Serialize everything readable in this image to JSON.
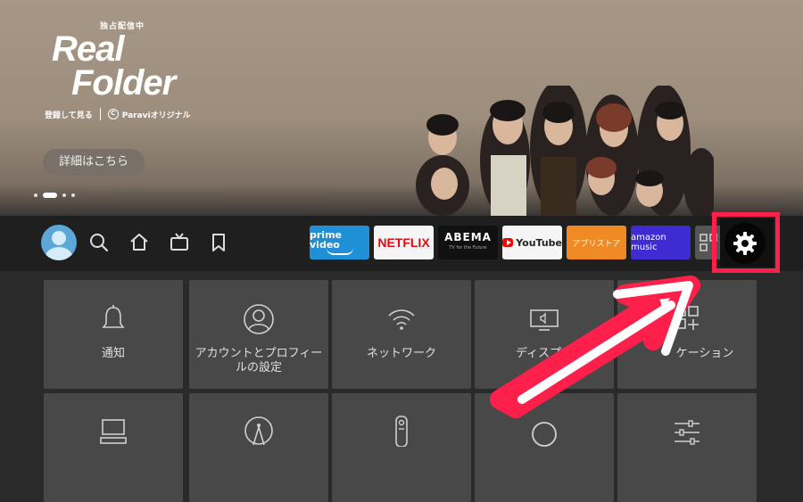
{
  "hero": {
    "kicker": "独占配信中",
    "title_line1": "Real",
    "title_line2": "Folder",
    "subtitle": "登録して見る",
    "brand": "Paraviオリジナル",
    "brand_mark": "C",
    "details_button": "詳細はこちら",
    "carousel_index": 2,
    "carousel_count": 4
  },
  "nav": {
    "items": [
      "profile-avatar",
      "search-icon",
      "home-icon",
      "live-tv-icon",
      "bookmark-icon"
    ]
  },
  "apps": [
    {
      "name": "prime video",
      "color": "#1f8fd6"
    },
    {
      "name": "NETFLIX",
      "color": "#e50914"
    },
    {
      "name": "ABEMA",
      "tagline": "TV for the Future",
      "color": "#111111"
    },
    {
      "name": "YouTube",
      "color": "#ff0000"
    },
    {
      "name": "アプリストア",
      "color": "#f08a24"
    },
    {
      "name": "amazon music",
      "color": "#3e2bd1"
    }
  ],
  "settings": {
    "icon": "gear-icon",
    "highlight_color": "#ff1f4b"
  },
  "tiles": {
    "notifications": "通知",
    "account_line1": "アカウントとプロフィー",
    "account_line2": "ルの設定",
    "network": "ネットワーク",
    "display_line1": "ディスプレ",
    "display_line2": "サ",
    "app_line1": "ケーション"
  },
  "annotation": {
    "arrow_color": "#ff1f4b"
  }
}
